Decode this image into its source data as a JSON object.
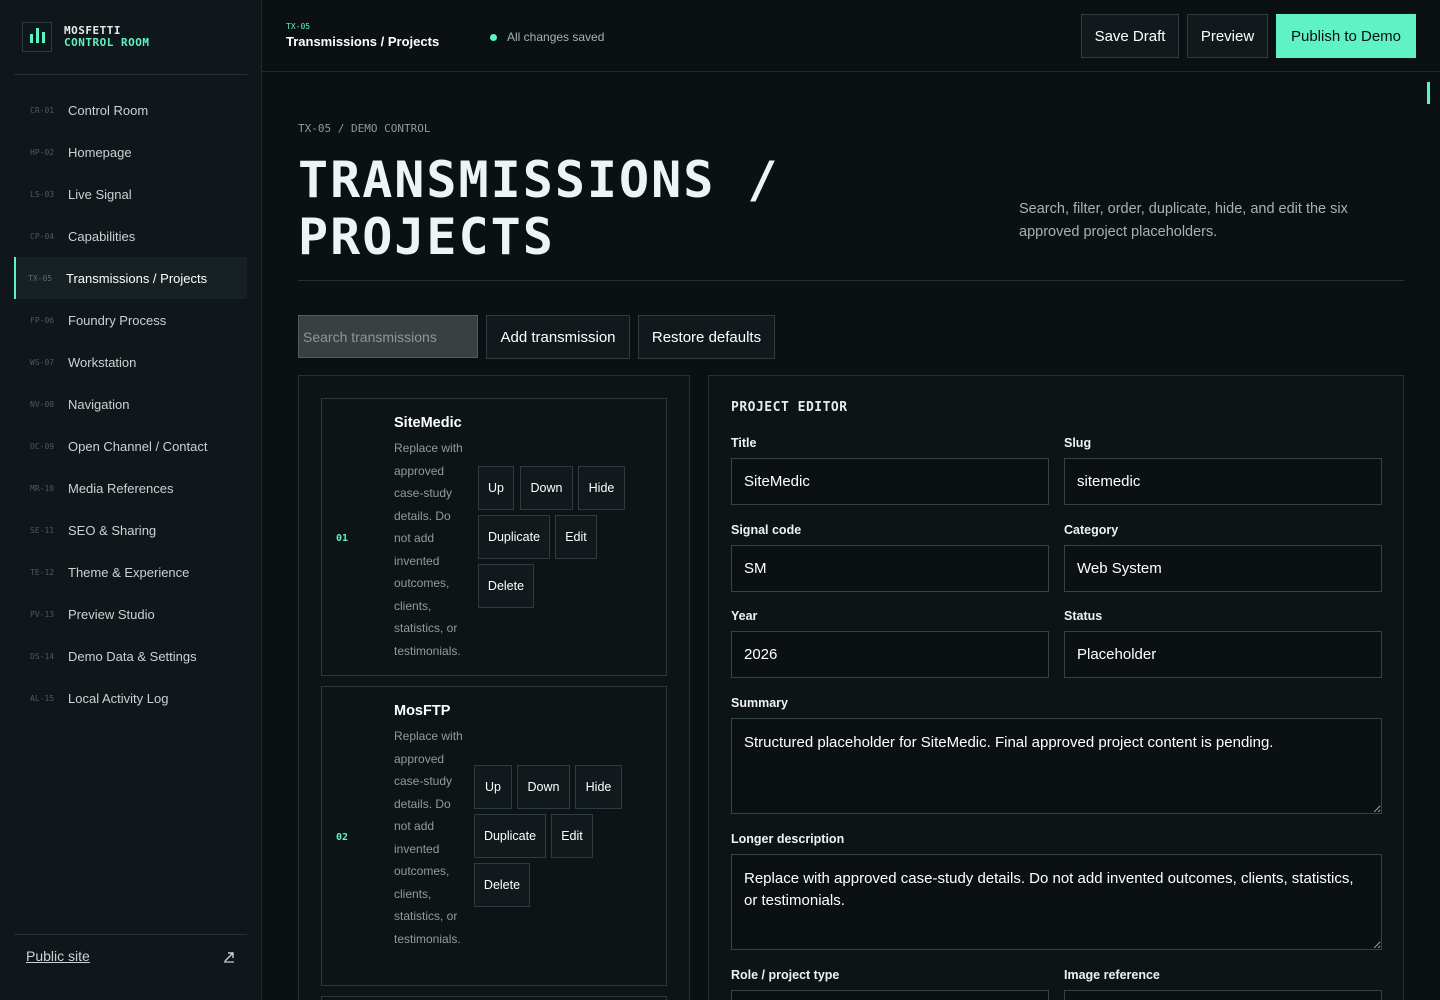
{
  "brand": {
    "line1": "MOSFETTI",
    "line2": "CONTROL ROOM"
  },
  "sidebar": {
    "items": [
      {
        "code": "CR-01",
        "label": "Control Room"
      },
      {
        "code": "HP-02",
        "label": "Homepage"
      },
      {
        "code": "LS-03",
        "label": "Live Signal"
      },
      {
        "code": "CP-04",
        "label": "Capabilities"
      },
      {
        "code": "TX-05",
        "label": "Transmissions / Projects"
      },
      {
        "code": "FP-06",
        "label": "Foundry Process"
      },
      {
        "code": "WS-07",
        "label": "Workstation"
      },
      {
        "code": "NV-08",
        "label": "Navigation"
      },
      {
        "code": "OC-09",
        "label": "Open Channel / Contact"
      },
      {
        "code": "MR-10",
        "label": "Media References"
      },
      {
        "code": "SE-11",
        "label": "SEO & Sharing"
      },
      {
        "code": "TE-12",
        "label": "Theme & Experience"
      },
      {
        "code": "PV-13",
        "label": "Preview Studio"
      },
      {
        "code": "DS-14",
        "label": "Demo Data & Settings"
      },
      {
        "code": "AL-15",
        "label": "Local Activity Log"
      }
    ],
    "active_index": 4,
    "public_site": "Public site"
  },
  "topbar": {
    "code": "TX-05",
    "title": "Transmissions / Projects",
    "status": "All changes saved",
    "save_draft": "Save Draft",
    "preview": "Preview",
    "publish": "Publish to Demo"
  },
  "page": {
    "eyebrow": "TX-05 / DEMO CONTROL",
    "title": "TRANSMISSIONS / PROJECTS",
    "description": "Search, filter, order, duplicate, hide, and edit the six approved project placeholders."
  },
  "toolbar": {
    "search_placeholder": "Search transmissions",
    "add": "Add transmission",
    "restore": "Restore defaults"
  },
  "list": {
    "actions": {
      "up": "Up",
      "down": "Down",
      "hide": "Hide",
      "duplicate": "Duplicate",
      "edit": "Edit",
      "delete": "Delete"
    },
    "items": [
      {
        "num": "01",
        "title": "SiteMedic",
        "desc": "Replace with approved case-study details. Do not add invented outcomes, clients, statistics, or testimonials."
      },
      {
        "num": "02",
        "title": "MosFTP",
        "desc": "Replace with approved case-study details. Do not add invented outcomes, clients, statistics, or testimonials."
      }
    ]
  },
  "editor": {
    "heading": "PROJECT EDITOR",
    "labels": {
      "title": "Title",
      "slug": "Slug",
      "signal_code": "Signal code",
      "category": "Category",
      "year": "Year",
      "status": "Status",
      "summary": "Summary",
      "longer_description": "Longer description",
      "role": "Role / project type",
      "image": "Image reference"
    },
    "values": {
      "title": "SiteMedic",
      "slug": "sitemedic",
      "signal_code": "SM",
      "category": "Web System",
      "year": "2026",
      "status": "Placeholder",
      "summary": "Structured placeholder for SiteMedic. Final approved project content is pending.",
      "longer_description": "Replace with approved case-study details. Do not add invented outcomes, clients, statistics, or testimonials."
    }
  }
}
